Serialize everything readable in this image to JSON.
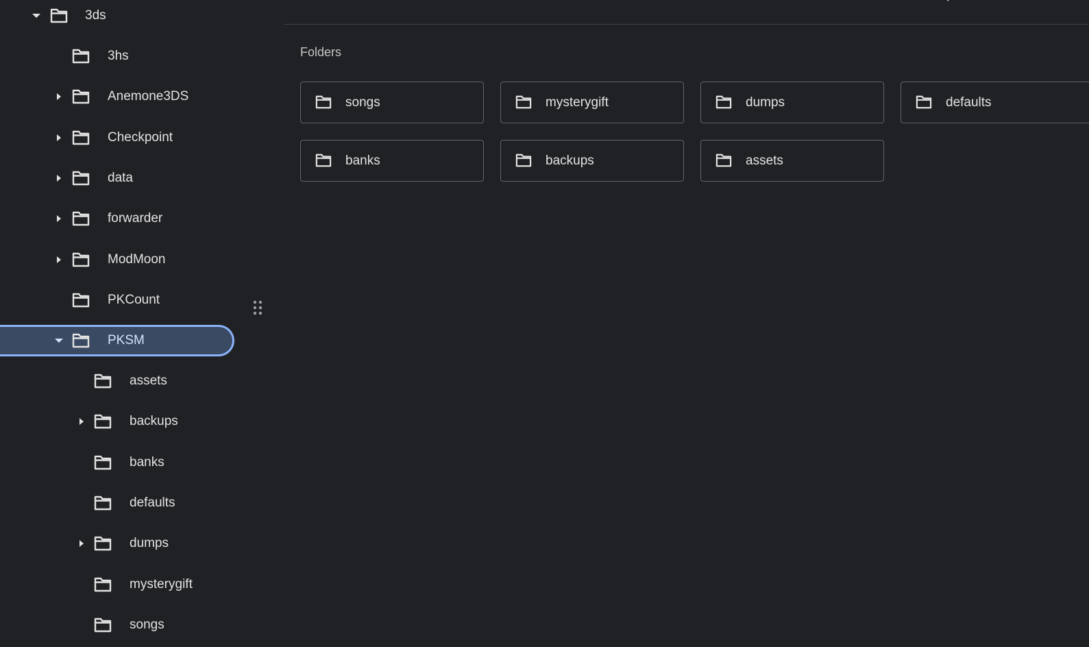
{
  "colors": {
    "background": "#202124",
    "text": "#e3e3e3",
    "selected_bg": "#3a4a63",
    "selected_border": "#8ab4f8",
    "tile_border": "#5f6368"
  },
  "tree": {
    "root": {
      "label": "3ds",
      "expanded": true
    },
    "items": [
      {
        "label": "3hs",
        "has_children": false
      },
      {
        "label": "Anemone3DS",
        "has_children": true
      },
      {
        "label": "Checkpoint",
        "has_children": true
      },
      {
        "label": "data",
        "has_children": true
      },
      {
        "label": "forwarder",
        "has_children": true
      },
      {
        "label": "ModMoon",
        "has_children": true
      },
      {
        "label": "PKCount",
        "has_children": false
      },
      {
        "label": "PKSM",
        "has_children": true,
        "expanded": true,
        "selected": true
      }
    ],
    "pksm_children": [
      {
        "label": "assets",
        "has_children": false
      },
      {
        "label": "backups",
        "has_children": true
      },
      {
        "label": "banks",
        "has_children": false
      },
      {
        "label": "defaults",
        "has_children": false
      },
      {
        "label": "dumps",
        "has_children": true
      },
      {
        "label": "mysterygift",
        "has_children": false
      },
      {
        "label": "songs",
        "has_children": false
      }
    ]
  },
  "main": {
    "section_title": "Folders",
    "folders": [
      {
        "label": "songs"
      },
      {
        "label": "mysterygift"
      },
      {
        "label": "dumps"
      },
      {
        "label": "defaults"
      },
      {
        "label": "banks"
      },
      {
        "label": "backups"
      },
      {
        "label": "assets"
      }
    ]
  },
  "icons": {
    "folder": "folder-icon",
    "caret_right": "chevron-right-icon",
    "caret_down": "chevron-down-icon",
    "drag": "drag-handle-icon"
  }
}
